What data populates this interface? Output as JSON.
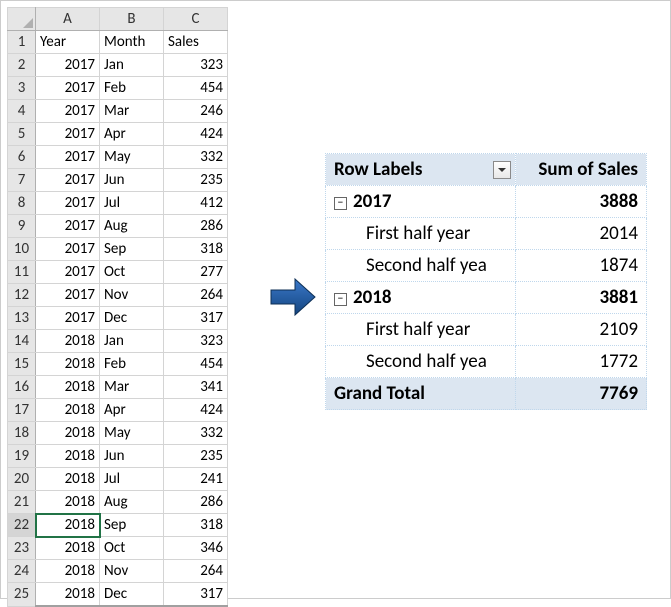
{
  "sheet": {
    "col_headers": [
      "A",
      "B",
      "C"
    ],
    "headers": [
      "Year",
      "Month",
      "Sales"
    ],
    "active_row": 22,
    "active_col": 0,
    "rows": [
      {
        "n": 1,
        "year": "Year",
        "month": "Month",
        "sales": "Sales",
        "is_header": true
      },
      {
        "n": 2,
        "year": 2017,
        "month": "Jan",
        "sales": 323
      },
      {
        "n": 3,
        "year": 2017,
        "month": "Feb",
        "sales": 454
      },
      {
        "n": 4,
        "year": 2017,
        "month": "Mar",
        "sales": 246
      },
      {
        "n": 5,
        "year": 2017,
        "month": "Apr",
        "sales": 424
      },
      {
        "n": 6,
        "year": 2017,
        "month": "May",
        "sales": 332
      },
      {
        "n": 7,
        "year": 2017,
        "month": "Jun",
        "sales": 235
      },
      {
        "n": 8,
        "year": 2017,
        "month": "Jul",
        "sales": 412
      },
      {
        "n": 9,
        "year": 2017,
        "month": "Aug",
        "sales": 286
      },
      {
        "n": 10,
        "year": 2017,
        "month": "Sep",
        "sales": 318
      },
      {
        "n": 11,
        "year": 2017,
        "month": "Oct",
        "sales": 277
      },
      {
        "n": 12,
        "year": 2017,
        "month": "Nov",
        "sales": 264
      },
      {
        "n": 13,
        "year": 2017,
        "month": "Dec",
        "sales": 317
      },
      {
        "n": 14,
        "year": 2018,
        "month": "Jan",
        "sales": 323
      },
      {
        "n": 15,
        "year": 2018,
        "month": "Feb",
        "sales": 454
      },
      {
        "n": 16,
        "year": 2018,
        "month": "Mar",
        "sales": 341
      },
      {
        "n": 17,
        "year": 2018,
        "month": "Apr",
        "sales": 424
      },
      {
        "n": 18,
        "year": 2018,
        "month": "May",
        "sales": 332
      },
      {
        "n": 19,
        "year": 2018,
        "month": "Jun",
        "sales": 235
      },
      {
        "n": 20,
        "year": 2018,
        "month": "Jul",
        "sales": 241
      },
      {
        "n": 21,
        "year": 2018,
        "month": "Aug",
        "sales": 286
      },
      {
        "n": 22,
        "year": 2018,
        "month": "Sep",
        "sales": 318
      },
      {
        "n": 23,
        "year": 2018,
        "month": "Oct",
        "sales": 346
      },
      {
        "n": 24,
        "year": 2018,
        "month": "Nov",
        "sales": 264
      },
      {
        "n": 25,
        "year": 2018,
        "month": "Dec",
        "sales": 317
      }
    ]
  },
  "pivot": {
    "row_labels_header": "Row Labels",
    "sum_header": "Sum of Sales",
    "rows": [
      {
        "type": "year",
        "label": "2017",
        "value": 3888
      },
      {
        "type": "sub",
        "label": "First half year",
        "value": 2014
      },
      {
        "type": "sub",
        "label": "Second half yea",
        "value": 1874
      },
      {
        "type": "year",
        "label": "2018",
        "value": 3881
      },
      {
        "type": "sub",
        "label": "First half year",
        "value": 2109
      },
      {
        "type": "sub",
        "label": "Second half yea",
        "value": 1772
      }
    ],
    "grand_label": "Grand Total",
    "grand_value": 7769
  }
}
